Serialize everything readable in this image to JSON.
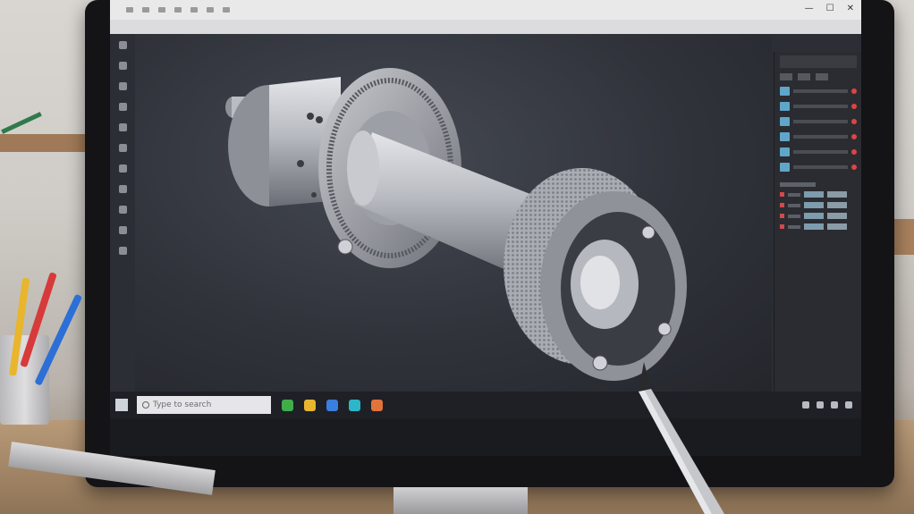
{
  "taskbar": {
    "search_placeholder": "Type to search",
    "apps": [
      {
        "icon": "green-app-icon",
        "color": "#3fae4a"
      },
      {
        "icon": "yellow-app-icon",
        "color": "#e7b52e"
      },
      {
        "icon": "blue-app-icon",
        "color": "#3a7ee0"
      },
      {
        "icon": "teal-app-icon",
        "color": "#2db6c8"
      },
      {
        "icon": "orange-app-icon",
        "color": "#e0743a"
      }
    ]
  },
  "model": {
    "object": "3d-mechanical-shaft-assembly",
    "colors": {
      "metal_light": "#cfd1d6",
      "metal_mid": "#9a9da4",
      "metal_dark": "#5d6067"
    }
  },
  "colors": {
    "viewport_bg": "#30333a",
    "panel_bg": "#2a2c31",
    "taskbar_bg": "#1e2026"
  }
}
